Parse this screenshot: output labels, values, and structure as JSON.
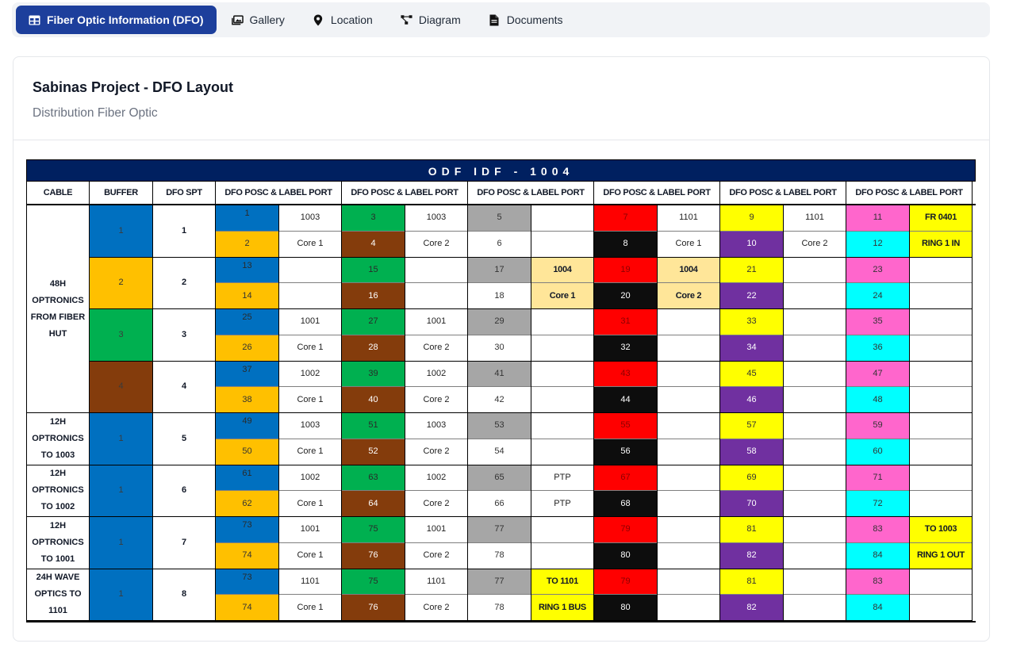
{
  "tabs": [
    {
      "label": "Fiber Optic Information (DFO)",
      "icon": "table-icon",
      "active": true
    },
    {
      "label": "Gallery",
      "icon": "image-icon",
      "active": false
    },
    {
      "label": "Location",
      "icon": "map-pin-icon",
      "active": false
    },
    {
      "label": "Diagram",
      "icon": "diagram-icon",
      "active": false
    },
    {
      "label": "Documents",
      "icon": "document-icon",
      "active": false
    }
  ],
  "card": {
    "title": "Sabinas Project - DFO Layout",
    "subtitle": "Distribution Fiber Optic"
  },
  "sheet": {
    "title": "ODF IDF - 1004",
    "headers": [
      "CABLE",
      "BUFFER",
      "DFO SPT",
      "DFO POSC & LABEL PORT",
      "DFO POSC & LABEL PORT",
      "DFO POSC & LABEL PORT",
      "DFO POSC & LABEL PORT",
      "DFO POSC & LABEL PORT",
      "DFO POSC & LABEL PORT"
    ],
    "colors": {
      "blue": "#0070c0",
      "orange": "#ffc000",
      "green": "#00b050",
      "brown": "#843c0c",
      "gray": "#a6a6a6",
      "white": "#ffffff",
      "red": "#ff0000",
      "black": "#0d0d0d",
      "yellow": "#ffff00",
      "purple": "#7030a0",
      "pink": "#ff66cc",
      "cyan": "#00ffff",
      "peach": "#ffe699"
    },
    "cables": [
      {
        "label": "48H OPTRONICS FROM FIBER HUT",
        "rows": 8
      },
      {
        "label": "12H OPTRONICS TO 1003",
        "rows": 2
      },
      {
        "label": "12H OPTRONICS TO 1002",
        "rows": 2
      },
      {
        "label": "12H OPTRONICS TO 1001",
        "rows": 2
      },
      {
        "label": "24H WAVE OPTICS TO 1101",
        "rows": 2
      }
    ],
    "buffers": [
      {
        "label": "1",
        "color": "blue"
      },
      {
        "label": "2",
        "color": "orange"
      },
      {
        "label": "3",
        "color": "green"
      },
      {
        "label": "4",
        "color": "brown"
      },
      {
        "label": "1",
        "color": "blue"
      },
      {
        "label": "1",
        "color": "blue"
      },
      {
        "label": "1",
        "color": "blue"
      },
      {
        "label": "1",
        "color": "blue"
      }
    ],
    "spts": [
      "1",
      "2",
      "3",
      "4",
      "5",
      "6",
      "7",
      "8"
    ],
    "groups": [
      {
        "num_colors": [
          "blue",
          "orange"
        ],
        "nums": [
          "1",
          "2",
          "13",
          "14",
          "25",
          "26",
          "37",
          "38",
          "49",
          "50",
          "61",
          "62",
          "73",
          "74",
          "73",
          "74"
        ],
        "labels": [
          "1003",
          "Core 1",
          "",
          "",
          "1001",
          "Core 1",
          "1002",
          "Core 1",
          "1003",
          "Core 1",
          "1002",
          "Core 1",
          "1001",
          "Core 1",
          "1101",
          "Core 1"
        ],
        "label_colors": []
      },
      {
        "num_colors": [
          "green",
          "brown"
        ],
        "nums": [
          "3",
          "4",
          "15",
          "16",
          "27",
          "28",
          "39",
          "40",
          "51",
          "52",
          "63",
          "64",
          "75",
          "76",
          "75",
          "76"
        ],
        "labels": [
          "1003",
          "Core 2",
          "",
          "",
          "1001",
          "Core 2",
          "1002",
          "Core 2",
          "1003",
          "Core 2",
          "1002",
          "Core 2",
          "1001",
          "Core 2",
          "1101",
          "Core 2"
        ],
        "label_colors": []
      },
      {
        "num_colors": [
          "gray",
          "white"
        ],
        "nums": [
          "5",
          "6",
          "17",
          "18",
          "29",
          "30",
          "41",
          "42",
          "53",
          "54",
          "65",
          "66",
          "77",
          "78",
          "77",
          "78"
        ],
        "labels": [
          "",
          "",
          "1004",
          "Core 1",
          "",
          "",
          "",
          "",
          "",
          "",
          "PTP",
          "PTP",
          "",
          "",
          "TO 1101",
          "RING 1 BUS"
        ],
        "label_colors": {
          "2": "peach",
          "3": "peach",
          "14": "yellow",
          "15": "yellow"
        },
        "bold_labels": [
          2,
          3,
          14,
          15
        ]
      },
      {
        "num_colors": [
          "red",
          "black"
        ],
        "nums": [
          "7",
          "8",
          "19",
          "20",
          "31",
          "32",
          "43",
          "44",
          "55",
          "56",
          "67",
          "68",
          "79",
          "80",
          "79",
          "80"
        ],
        "labels": [
          "1101",
          "Core 1",
          "1004",
          "Core 2",
          "",
          "",
          "",
          "",
          "",
          "",
          "",
          "",
          "",
          "",
          "",
          ""
        ],
        "label_colors": {
          "2": "peach",
          "3": "peach"
        },
        "bold_labels": [
          2,
          3
        ]
      },
      {
        "num_colors": [
          "yellow",
          "purple"
        ],
        "nums": [
          "9",
          "10",
          "21",
          "22",
          "33",
          "34",
          "45",
          "46",
          "57",
          "58",
          "69",
          "70",
          "81",
          "82",
          "81",
          "82"
        ],
        "labels": [
          "1101",
          "Core 2",
          "",
          "",
          "",
          "",
          "",
          "",
          "",
          "",
          "",
          "",
          "",
          "",
          "",
          ""
        ],
        "label_colors": {}
      },
      {
        "num_colors": [
          "pink",
          "cyan"
        ],
        "nums": [
          "11",
          "12",
          "23",
          "24",
          "35",
          "36",
          "47",
          "48",
          "59",
          "60",
          "71",
          "72",
          "83",
          "84",
          "83",
          "84"
        ],
        "labels": [
          "FR 0401",
          "RING 1 IN",
          "",
          "",
          "",
          "",
          "",
          "",
          "",
          "",
          "",
          "",
          "TO 1003",
          "RING 1 OUT",
          "",
          ""
        ],
        "label_colors": {
          "0": "yellow",
          "1": "yellow",
          "12": "yellow",
          "13": "yellow"
        },
        "bold_labels": [
          0,
          1,
          12,
          13
        ]
      }
    ]
  }
}
